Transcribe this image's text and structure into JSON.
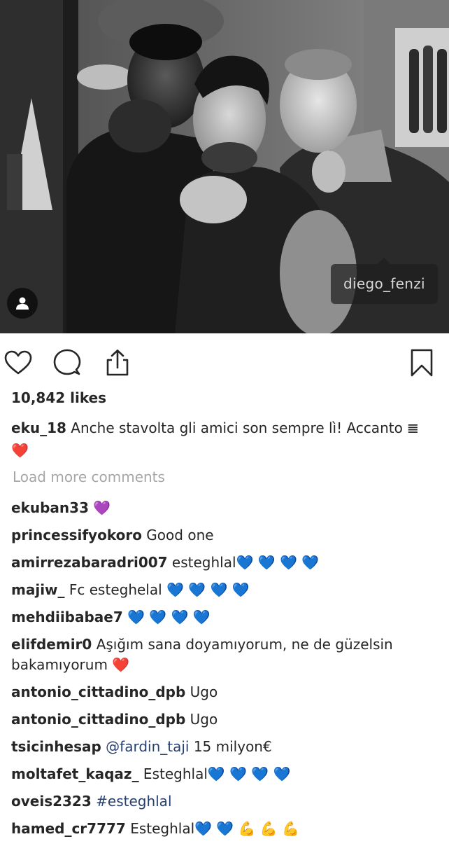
{
  "post": {
    "tagged_user": "diego_fenzi",
    "likes": "10,842 likes",
    "caption": {
      "username": "eku_18",
      "text": "Anche stavolta gli amici son sempre lì! Accanto",
      "trailing_glyph": "𝌆",
      "trailing_emoji": "❤️"
    },
    "load_more": "Load more comments"
  },
  "icons": {
    "like": "heart-outline-icon",
    "comment": "speech-bubble-icon",
    "share": "share-upload-icon",
    "save": "bookmark-icon",
    "tags": "person-icon"
  },
  "comments": [
    {
      "username": "ekuban33",
      "text": " 💜"
    },
    {
      "username": "princessifyokoro",
      "text": " Good one"
    },
    {
      "username": "amirrezabaradri007",
      "text": " esteghlal💙 💙 💙 💙"
    },
    {
      "username": "majiw_",
      "text": " Fc esteghelal 💙 💙 💙 💙"
    },
    {
      "username": "mehdiibabae7",
      "text": " 💙 💙 💙 💙"
    },
    {
      "username": "elifdemir0",
      "text": " Aşığım sana doyamıyorum, ne de güzelsin bakamıyorum ❤️"
    },
    {
      "username": "antonio_cittadino_dpb",
      "text": " Ugo"
    },
    {
      "username": "antonio_cittadino_dpb",
      "text": " Ugo"
    },
    {
      "username": "tsicinhesap",
      "mention": "@fardin_taji",
      "text": " 15 milyon€"
    },
    {
      "username": "moltafet_kaqaz_",
      "text": " Esteghlal💙 💙 💙 💙"
    },
    {
      "username": "oveis2323",
      "hashtag": "#esteghlal"
    },
    {
      "username": "hamed_cr7777",
      "text": " Esteghlal💙 💙 💪 💪 💪"
    }
  ],
  "colors": {
    "text": "#262626",
    "muted": "#a6a6a6",
    "link": "#27406e",
    "heart_red": "#e0202a",
    "heart_blue": "#1e7ef0",
    "heart_purple": "#9b45e0"
  }
}
